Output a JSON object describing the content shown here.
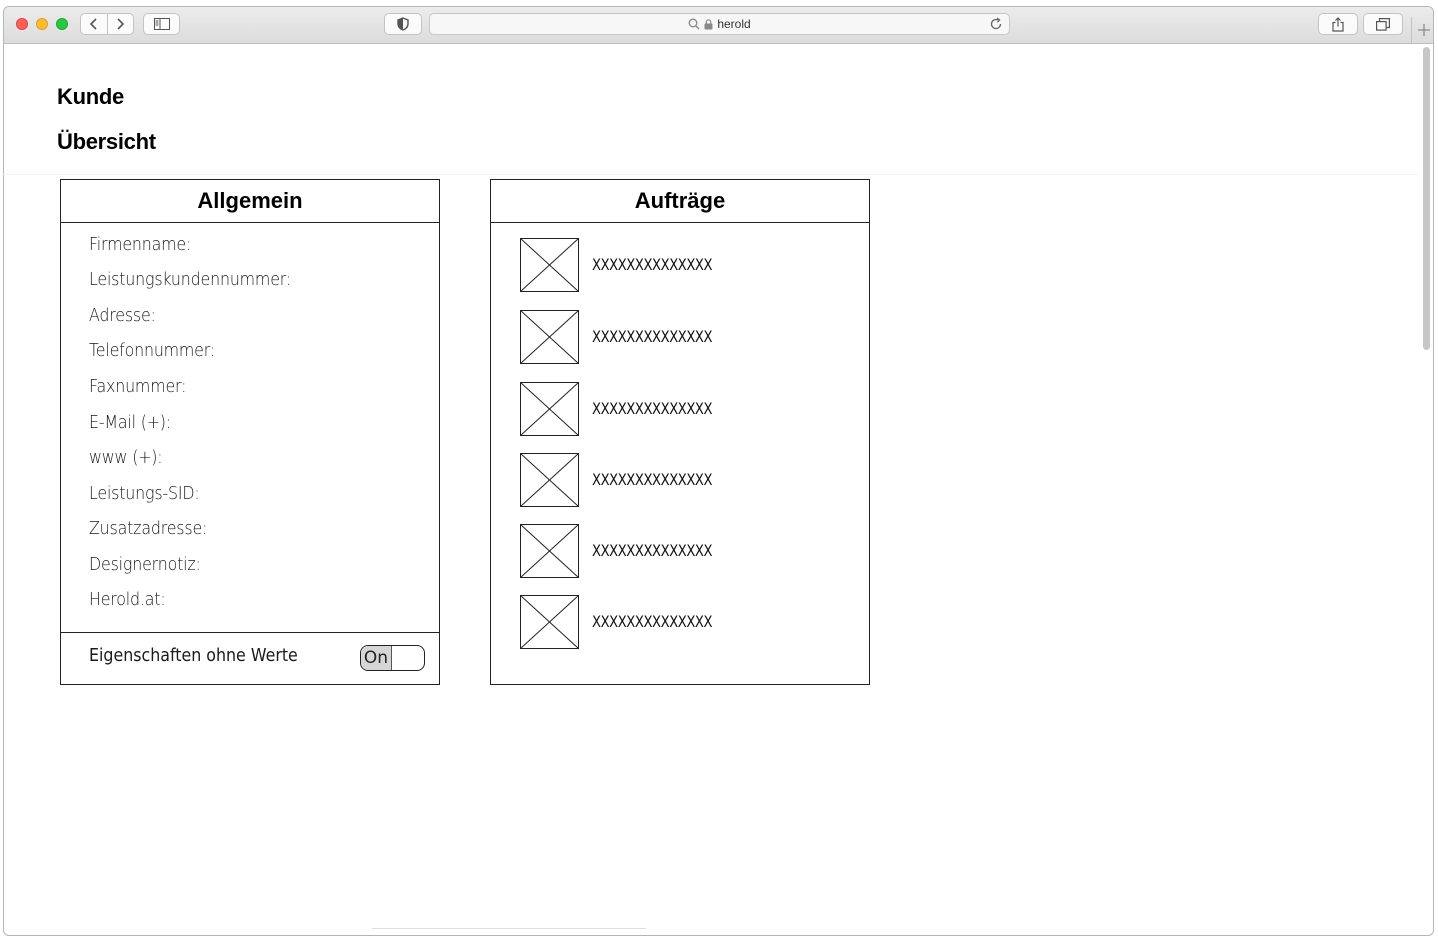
{
  "browser": {
    "address": "herold",
    "icons": [
      "back-icon",
      "forward-icon",
      "sidebar-icon",
      "shield-icon",
      "search-icon",
      "lock-icon",
      "reload-icon",
      "share-icon",
      "tabs-icon",
      "plus-icon"
    ]
  },
  "page": {
    "heading1": "Kunde",
    "heading2": "Übersicht"
  },
  "general": {
    "title": "Allgemein",
    "fields": [
      "Firmenname:",
      "Leistungskundennummer:",
      "Adresse:",
      "Telefonnummer:",
      "Faxnummer:",
      "E-Mail (+):",
      "www (+):",
      "Leistungs-SID:",
      "Zusatzadresse:",
      "Designernotiz:",
      "Herold.at:"
    ],
    "footer_label": "Eigenschaften ohne Werte",
    "toggle_label": "On"
  },
  "orders": {
    "title": "Aufträge",
    "items": [
      "XXXXXXXXXXXXXX",
      "XXXXXXXXXXXXXX",
      "XXXXXXXXXXXXXX",
      "XXXXXXXXXXXXXX",
      "XXXXXXXXXXXXXX",
      "XXXXXXXXXXXXXX"
    ]
  }
}
